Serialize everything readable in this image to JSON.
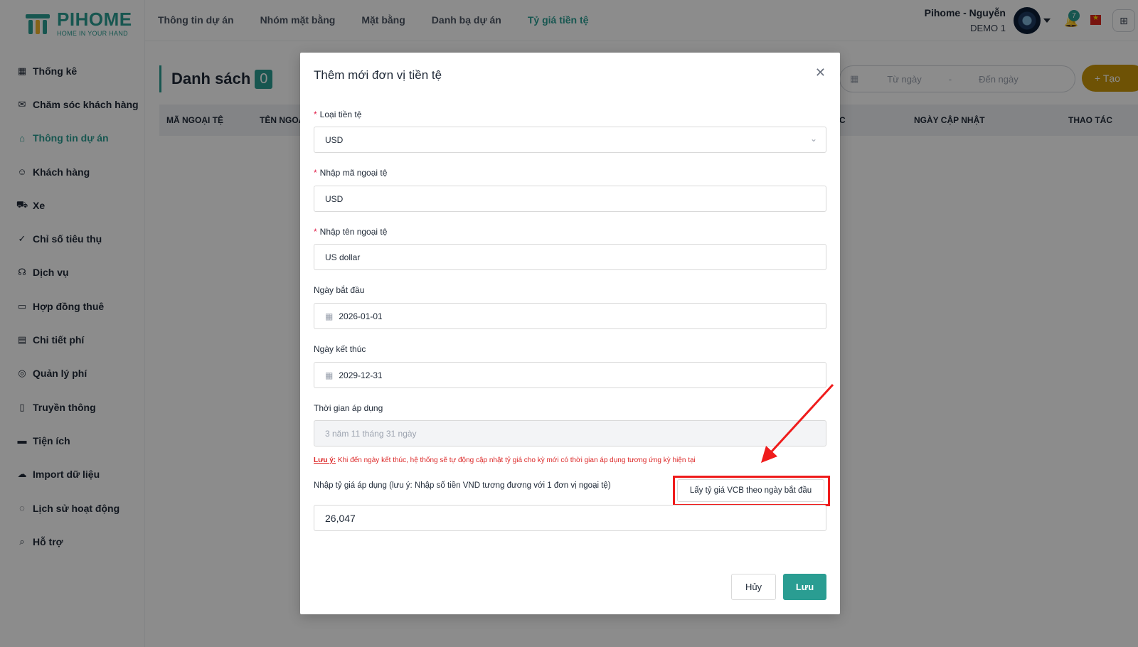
{
  "brand": {
    "name": "PIHOME",
    "tagline": "HOME IN YOUR HAND"
  },
  "sidebar": {
    "items": [
      {
        "label": "Thống kê",
        "icon": "grid-icon"
      },
      {
        "label": "Chăm sóc khách hàng",
        "icon": "mail-icon"
      },
      {
        "label": "Thông tin dự án",
        "icon": "home-icon",
        "active": true
      },
      {
        "label": "Khách hàng",
        "icon": "user-icon"
      },
      {
        "label": "Xe",
        "icon": "car-icon"
      },
      {
        "label": "Chỉ số tiêu thụ",
        "icon": "checklist-icon"
      },
      {
        "label": "Dịch vụ",
        "icon": "headset-icon"
      },
      {
        "label": "Hợp đồng thuê",
        "icon": "folder-icon"
      },
      {
        "label": "Chi tiết phí",
        "icon": "invoice-icon"
      },
      {
        "label": "Quản lý phí",
        "icon": "coins-icon"
      },
      {
        "label": "Truyền thông",
        "icon": "document-icon"
      },
      {
        "label": "Tiện ích",
        "icon": "tray-icon"
      },
      {
        "label": "Import dữ liệu",
        "icon": "cloud-upload-icon"
      },
      {
        "label": "Lịch sử hoạt động",
        "icon": "lifebuoy-icon"
      },
      {
        "label": "Hỗ trợ",
        "icon": "search-icon"
      }
    ]
  },
  "topnav": {
    "items": [
      {
        "label": "Thông tin dự án"
      },
      {
        "label": "Nhóm mặt bằng"
      },
      {
        "label": "Mặt bằng"
      },
      {
        "label": "Danh bạ dự án"
      },
      {
        "label": "Tỷ giá tiền tệ",
        "active": true
      }
    ]
  },
  "user": {
    "name": "Pihome - Nguyễn",
    "project": "DEMO 1",
    "notifications": "7"
  },
  "page": {
    "title": "Danh sách",
    "count": "0",
    "date_from_placeholder": "Từ ngày",
    "date_to_placeholder": "Đến ngày",
    "date_separator": "-",
    "create_label": "+ Tạo",
    "columns": [
      "MÃ NGOẠI TỆ",
      "TÊN NGOẠ",
      "C",
      "NGÀY CẬP NHẬT",
      "THAO TÁC"
    ]
  },
  "modal": {
    "title": "Thêm mới đơn vị tiền tệ",
    "currency_type": {
      "label": "Loại tiền tệ",
      "value": "USD"
    },
    "code": {
      "label": "Nhập mã ngoại tệ",
      "value": "USD"
    },
    "name": {
      "label": "Nhập tên ngoại tệ",
      "value": "US dollar"
    },
    "start_date": {
      "label": "Ngày bắt đầu",
      "value": "2026-01-01"
    },
    "end_date": {
      "label": "Ngày kết thúc",
      "value": "2029-12-31"
    },
    "duration": {
      "label": "Thời gian áp dụng",
      "value": "3 năm 11 tháng 31 ngày"
    },
    "note_prefix": "Lưu ý:",
    "note_text": " Khi đến ngày kết thúc, hệ thống sẽ tự động cập nhật tỷ giá cho kỳ mới có thời gian áp dụng tương ứng kỳ hiện tại",
    "rate": {
      "label": "Nhập tỷ giá áp dụng (lưu ý: Nhập số tiền VND tương đương với 1 đơn vị ngoại tệ)",
      "value": "26,047"
    },
    "vcb_button": "Lấy tỷ giá VCB theo ngày bắt đầu",
    "cancel": "Hủy",
    "save": "Lưu"
  },
  "annotation_color": "#ef1c1c"
}
